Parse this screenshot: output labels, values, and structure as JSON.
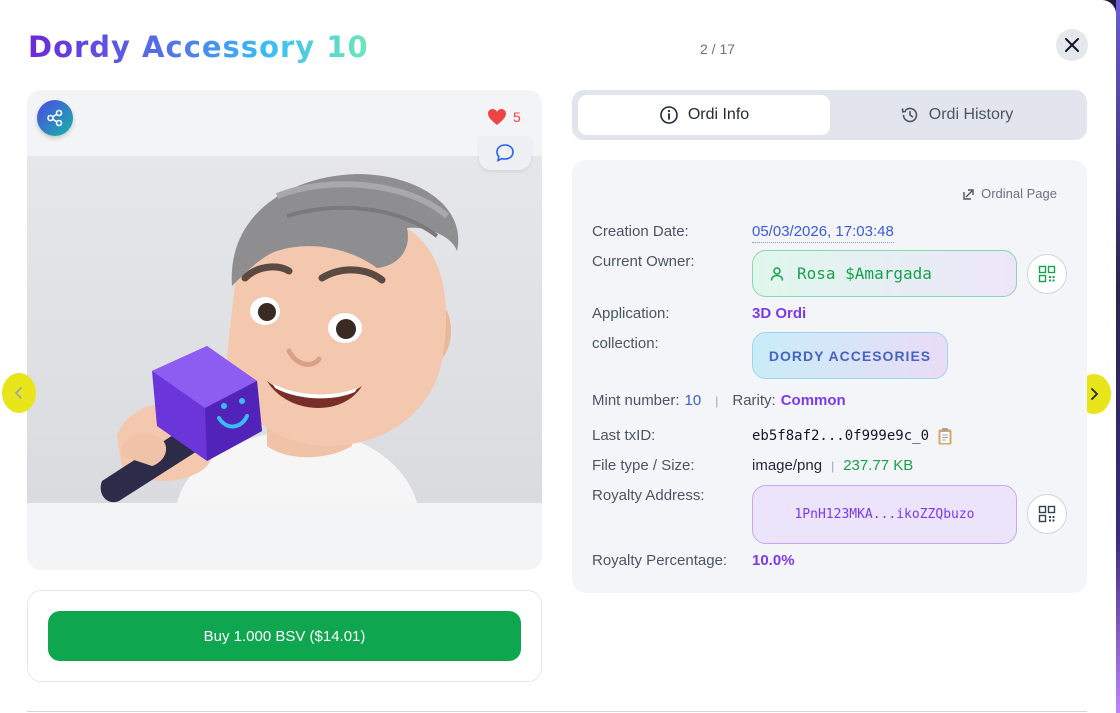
{
  "header": {
    "title": "Dordy Accessory 10",
    "counter": "2 / 17"
  },
  "media": {
    "likes": "5"
  },
  "buy": {
    "label": "Buy 1.000 BSV ($14.01)"
  },
  "tabs": [
    {
      "label": "Ordi Info",
      "active": true
    },
    {
      "label": "Ordi History",
      "active": false
    }
  ],
  "info": {
    "ordinal_link": "Ordinal Page",
    "creation_label": "Creation Date:",
    "creation_value": "05/03/2026, 17:03:48",
    "owner_label": "Current Owner:",
    "owner_value": "Rosa $Amargada",
    "application_label": "Application:",
    "application_value": "3D Ordi",
    "collection_label": "collection:",
    "collection_value": "DORDY ACCESORIES",
    "mint_label": "Mint number:",
    "mint_value": "10",
    "rarity_label": "Rarity:",
    "rarity_value": "Common",
    "txid_label": "Last txID:",
    "txid_value": "eb5f8af2...0f999e9c_0",
    "filetype_label": "File type / Size:",
    "filetype_value": "image/png",
    "filesize_value": "237.77 KB",
    "royalty_address_label": "Royalty Address:",
    "royalty_address_value": "1PnH123MKA...ikoZZQbuzo",
    "royalty_pct_label": "Royalty Percentage:",
    "royalty_pct_value": "10.0%"
  },
  "colors": {
    "buy_button": "#0fa650",
    "accent_purple": "#7c3aed",
    "nav_highlight": "#e8e51a"
  }
}
